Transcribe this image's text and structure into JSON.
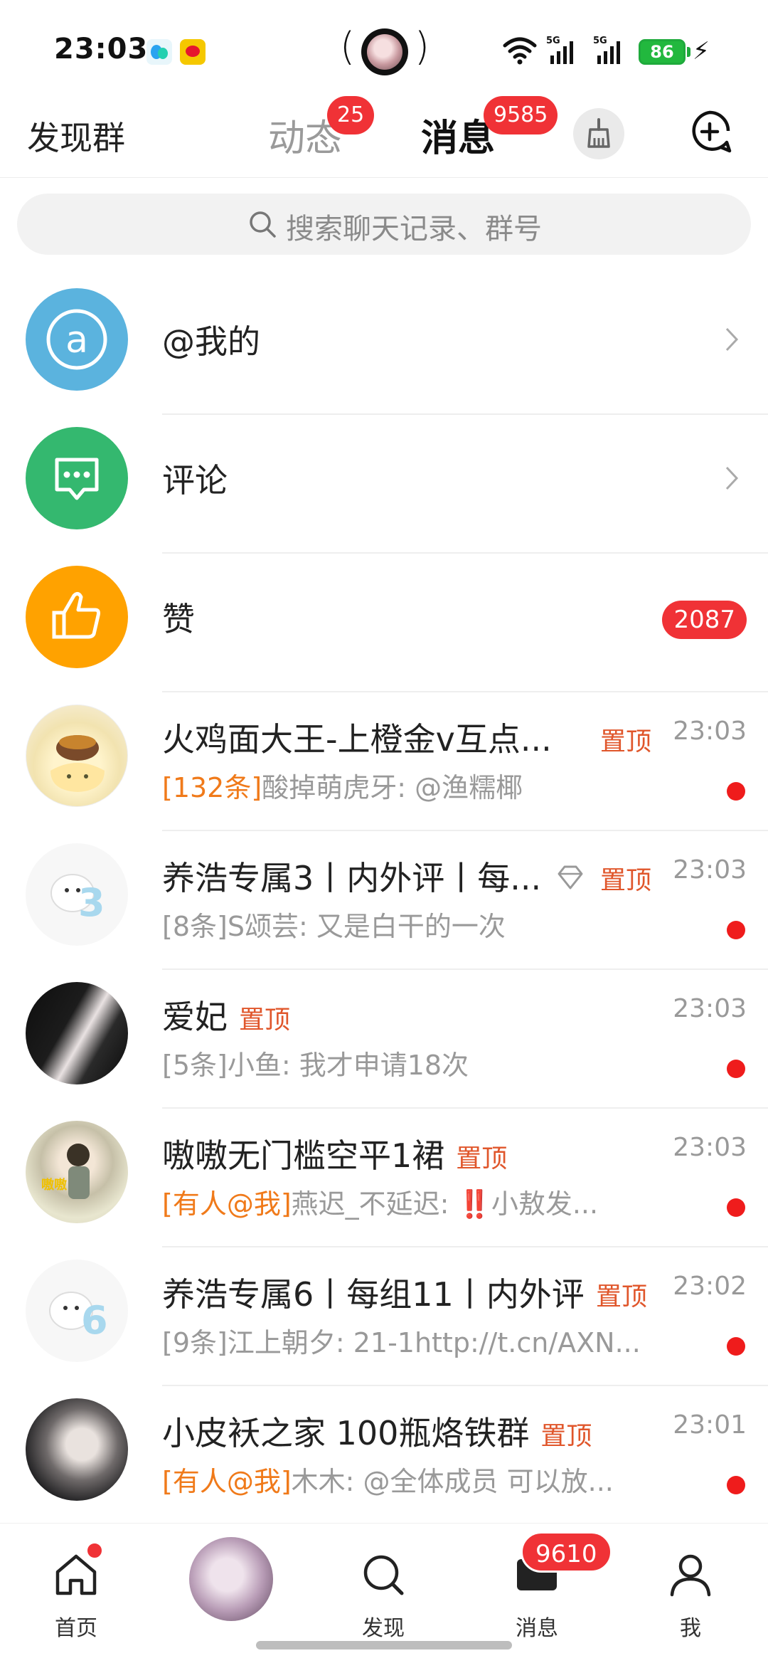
{
  "status_bar": {
    "time": "23:03",
    "battery": "86",
    "net1": "5G",
    "net2": "5G"
  },
  "topnav": {
    "left_label": "发现群",
    "tabs": [
      {
        "label": "动态",
        "badge": "25"
      },
      {
        "label": "消息",
        "badge": "9585"
      }
    ]
  },
  "search": {
    "placeholder": "搜索聊天记录、群号"
  },
  "system_items": [
    {
      "label": "@我的",
      "icon": "at-icon",
      "color": "#5bb3de"
    },
    {
      "label": "评论",
      "icon": "comment-icon",
      "color": "#34b86f"
    },
    {
      "label": "赞",
      "icon": "thumbs-up-icon",
      "color": "#ffa200",
      "badge": "2087"
    }
  ],
  "chats": [
    {
      "title": "火鸡面大王-上橙金v互点...",
      "pinned": "置顶",
      "time": "23:03",
      "prefix": "[132条]",
      "prefix_highlight": true,
      "preview": "酸掉萌虎牙: @渔糯椰"
    },
    {
      "title": "养浩专属3丨内外评丨每...",
      "pinned": "置顶",
      "time": "23:03",
      "prefix": "[8条]",
      "prefix_highlight": false,
      "preview": "S颂芸: 又是白干的一次"
    },
    {
      "title": "爱妃",
      "pinned": "置顶",
      "time": "23:03",
      "prefix": "[5条]",
      "prefix_highlight": false,
      "preview": "小鱼: 我才申请18次"
    },
    {
      "title": "嗷嗷无门槛空平1裙",
      "pinned": "置顶",
      "time": "23:03",
      "prefix": "[有人@我]",
      "prefix_highlight": true,
      "preview": "燕迟_不延迟: ‼️小敖发..."
    },
    {
      "title": "养浩专属6丨每组11丨内外评",
      "pinned": "置顶",
      "time": "23:02",
      "prefix": "[9条]",
      "prefix_highlight": false,
      "preview": "江上朝夕: 21-1http://t.cn/AXN..."
    },
    {
      "title": "小皮袄之家 100瓶烙铁群",
      "pinned": "置顶",
      "time": "23:01",
      "prefix": "[有人@我]",
      "prefix_highlight": true,
      "preview": "木木: @全体成员 可以放..."
    }
  ],
  "bottomnav": {
    "items": [
      {
        "label": "首页",
        "icon": "home-icon"
      },
      {
        "label": "",
        "icon": "avatar"
      },
      {
        "label": "发现",
        "icon": "discover-search-icon"
      },
      {
        "label": "消息",
        "icon": "message-icon",
        "badge": "9610"
      },
      {
        "label": "我",
        "icon": "profile-icon"
      }
    ]
  },
  "colors": {
    "accent": "#f03236",
    "pin": "#e0562b",
    "highlight": "#f07a1a",
    "tab_underline": "#ffb100"
  }
}
